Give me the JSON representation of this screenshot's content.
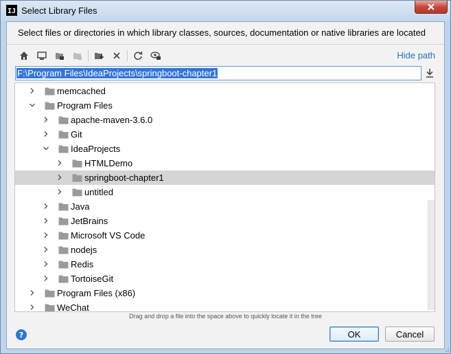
{
  "window": {
    "title": "Select Library Files",
    "app_icon_text": "IJ"
  },
  "description": "Select files or directories in which library classes, sources, documentation or native libraries are located",
  "toolbar": {
    "buttons": [
      "home-icon",
      "desktop-icon",
      "project-icon",
      "module-icon",
      "new-folder-icon",
      "delete-icon",
      "refresh-icon",
      "show-hidden-icon"
    ],
    "hide_path_label": "Hide path"
  },
  "path": {
    "value": "F:\\Program Files\\IdeaProjects\\springboot-chapter1"
  },
  "tree": {
    "rows": [
      {
        "label": "memcached",
        "depth": 1,
        "expanded": false,
        "selected": false
      },
      {
        "label": "Program Files",
        "depth": 1,
        "expanded": true,
        "selected": false
      },
      {
        "label": "apache-maven-3.6.0",
        "depth": 2,
        "expanded": false,
        "selected": false
      },
      {
        "label": "Git",
        "depth": 2,
        "expanded": false,
        "selected": false
      },
      {
        "label": "IdeaProjects",
        "depth": 2,
        "expanded": true,
        "selected": false
      },
      {
        "label": "HTMLDemo",
        "depth": 3,
        "expanded": false,
        "selected": false
      },
      {
        "label": "springboot-chapter1",
        "depth": 3,
        "expanded": false,
        "selected": true
      },
      {
        "label": "untitled",
        "depth": 3,
        "expanded": false,
        "selected": false
      },
      {
        "label": "Java",
        "depth": 2,
        "expanded": false,
        "selected": false
      },
      {
        "label": "JetBrains",
        "depth": 2,
        "expanded": false,
        "selected": false
      },
      {
        "label": "Microsoft VS Code",
        "depth": 2,
        "expanded": false,
        "selected": false
      },
      {
        "label": "nodejs",
        "depth": 2,
        "expanded": false,
        "selected": false
      },
      {
        "label": "Redis",
        "depth": 2,
        "expanded": false,
        "selected": false
      },
      {
        "label": "TortoiseGit",
        "depth": 2,
        "expanded": false,
        "selected": false
      },
      {
        "label": "Program Files (x86)",
        "depth": 1,
        "expanded": false,
        "selected": false
      },
      {
        "label": "WeChat",
        "depth": 1,
        "expanded": false,
        "selected": false
      }
    ]
  },
  "hint": "Drag and drop a file into the space above to quickly locate it in the tree",
  "buttons": {
    "ok": "OK",
    "cancel": "Cancel",
    "help": "?"
  },
  "colors": {
    "selection": "#3375d6",
    "link": "#2470b3",
    "folder": "#9a9a9a",
    "selected_row": "#d5d5d5"
  }
}
